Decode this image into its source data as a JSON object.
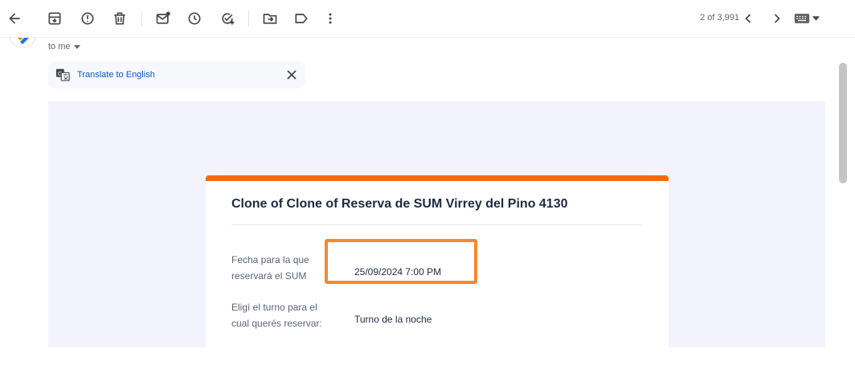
{
  "toolbar": {
    "icons": [
      "back-arrow-icon",
      "archive-icon",
      "report-spam-icon",
      "delete-icon",
      "mark-unread-icon",
      "snooze-icon",
      "add-to-tasks-icon",
      "move-to-icon",
      "label-icon",
      "more-vert-icon"
    ],
    "counter": "2 of 3,991"
  },
  "message": {
    "recipient": "to me"
  },
  "translate": {
    "link": "Translate to English"
  },
  "form": {
    "title": "Clone of Clone of Reserva de SUM Virrey del Pino 4130",
    "fields": [
      {
        "label": "Fecha para la que reservará el SUM",
        "value": "25/09/2024 7:00 PM"
      },
      {
        "label": "Eligí el turno para el cual querés reservar:",
        "value": "Turno de la noche"
      }
    ]
  },
  "colors": {
    "accent": "#f56a0b",
    "highlight": "#f6892e",
    "body_bg": "#f3f3fd",
    "link": "#0b57d0"
  }
}
